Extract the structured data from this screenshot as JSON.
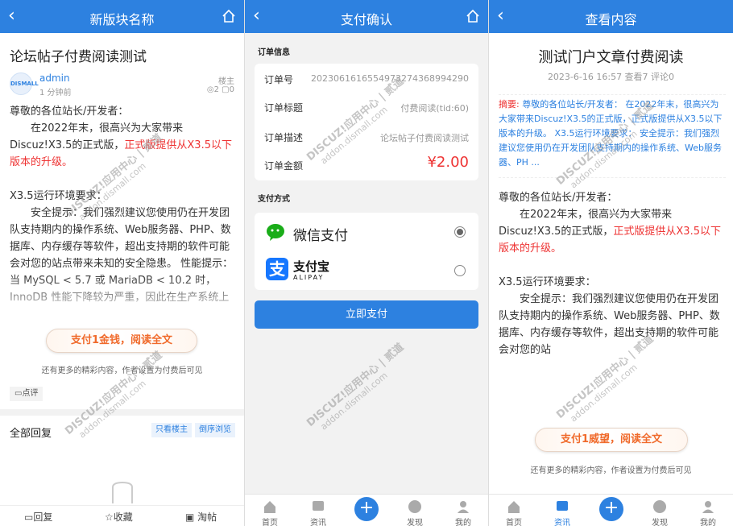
{
  "left": {
    "header_title": "新版块名称",
    "title": "论坛帖子付费阅读测试",
    "avatar_text": "DISMALL",
    "author": "admin",
    "time": "1 分钟前",
    "role": "楼主",
    "views": "2",
    "comments": "0",
    "para1": "尊敬的各位站长/开发者：",
    "para2_a": "在2022年末，很高兴为大家带来Discuz!X3.5的正式版，",
    "para2_b": "正式版提供从X3.5以下版本的升级。",
    "para3": "X3.5运行环境要求：",
    "para4": "安全提示：我们强烈建议您使用仍在开发团队支持期内的操作系统、Web服务器、PHP、数据库、内存缓存等软件，超出支持期的软件可能会对您的站点带来未知的安全隐患。 性能提示：当 MySQL < 5.7 或 MariaDB < 10.2 时，InnoDB 性能下降较为严重，因此在生产系统上运行的站点应升级版本至 MySQ",
    "pay_button": "支付1金钱，阅读全文",
    "hint": "还有更多的精彩内容，作者设置为付费后可见",
    "comment_btn": "点评",
    "all_replies": "全部回复",
    "only_owner": "只看楼主",
    "reverse": "倒序浏览",
    "reply": "回复",
    "favorite": "收藏",
    "drift": "淘帖"
  },
  "middle": {
    "header_title": "支付确认",
    "order_info": "订单信息",
    "rows": [
      {
        "label": "订单号",
        "value": "20230616165549732743689942 90"
      },
      {
        "label": "订单标题",
        "value": "付费阅读(tid:60)"
      },
      {
        "label": "订单描述",
        "value": "论坛帖子付费阅读测试"
      },
      {
        "label": "订单金额",
        "value": "¥2.00"
      }
    ],
    "order_no": "2023061616554973274368994290",
    "pay_method": "支付方式",
    "wechat": "微信支付",
    "alipay_cn": "支付宝",
    "alipay_en": "ALIPAY",
    "submit": "立即支付"
  },
  "right": {
    "header_title": "查看内容",
    "title": "测试门户文章付费阅读",
    "meta": "2023-6-16 16:57  查看7  评论0",
    "summary_label": "摘要:",
    "summary": "尊敬的各位站长/开发者： 在2022年末，很高兴为大家带来Discuz!X3.5的正式版，正式版提供从X3.5以下版本的升级。 X3.5运行环境要求： 安全提示：我们强烈建议您使用仍在开发团队支持期内的操作系统、Web服务器、PH ...",
    "para1": "尊敬的各位站长/开发者：",
    "para2_a": "在2022年末，很高兴为大家带来Discuz!X3.5的正式版，",
    "para2_b": "正式版提供从X3.5以下版本的升级。",
    "para3": "X3.5运行环境要求：",
    "para4": "安全提示：我们强烈建议您使用仍在开发团队支持期内的操作系统、Web服务器、PHP、数据库、内存缓存等软件，超出支持期的软件可能会对您的站",
    "pay_button": "支付1威望，阅读全文",
    "hint": "还有更多的精彩内容，作者设置为付费后可见"
  },
  "tabs": [
    "首页",
    "资讯",
    "发现",
    "我的"
  ],
  "watermark": {
    "line1": "DISCUZ!应用中心 | 贰道",
    "line2": "addon.dismall.com"
  },
  "colors": {
    "primary": "#2d81e0",
    "red": "#e33333",
    "orange": "#f06a2b",
    "wechat": "#1aad19",
    "alipay": "#1677ff"
  }
}
